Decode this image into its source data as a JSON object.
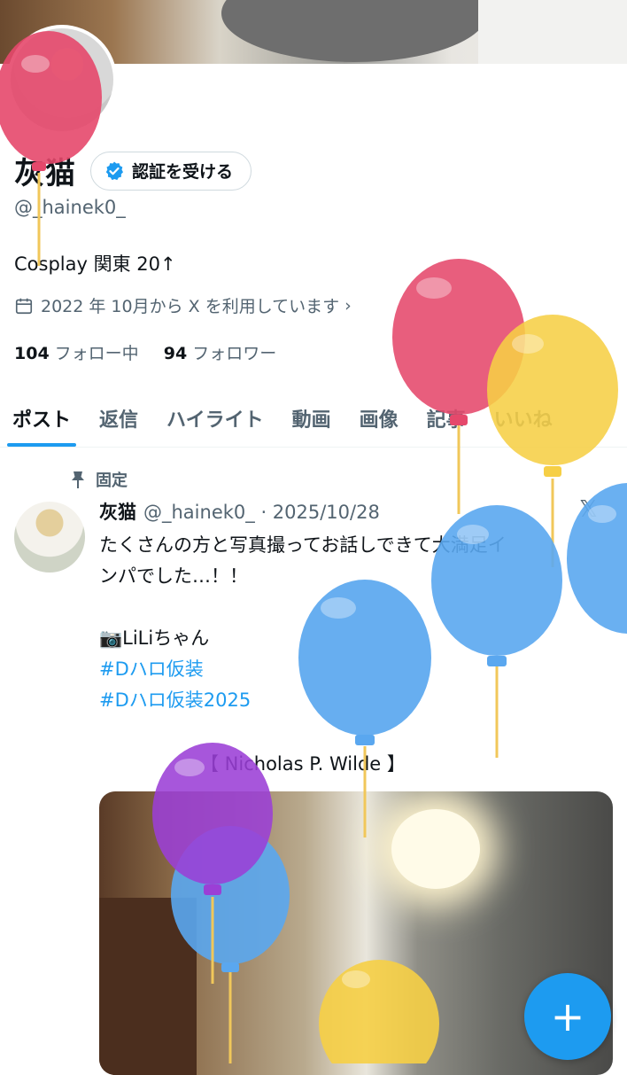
{
  "profile": {
    "name": "灰猫",
    "verify_label": "認証を受ける",
    "handle": "@_hainek0_",
    "bio": "Cosplay 関東 20↑",
    "joined": "2022 年 10月から X を利用しています",
    "following_count": "104",
    "following_label": "フォロー中",
    "followers_count": "94",
    "followers_label": "フォロワー"
  },
  "tabs": [
    {
      "label": "ポスト"
    },
    {
      "label": "返信"
    },
    {
      "label": "ハイライト"
    },
    {
      "label": "動画"
    },
    {
      "label": "画像"
    },
    {
      "label": "記事"
    },
    {
      "label": "いいね"
    }
  ],
  "post": {
    "pinned_label": "固定",
    "author": "灰猫",
    "handle_date": "@_hainek0_ · 2025/10/28",
    "text_line1": "たくさんの方と写真撮ってお話しできて大満足イ",
    "text_line2": "ンパでした…！！",
    "text_line3": "📷LiLiちゃん",
    "hashtag1": "#Dハロ仮装",
    "hashtag2": "#Dハロ仮装2025",
    "caption": "【 Nicholas P. Wilde 】"
  },
  "fab_label": "+",
  "colors": {
    "accent": "#1d9bf0",
    "balloon_red": "#e5486b",
    "balloon_yellow": "#f6cf45",
    "balloon_blue": "#5aa7ef",
    "balloon_purple": "#9b3fd6"
  },
  "icons": {
    "verified": "verified-badge-icon",
    "calendar": "calendar-icon",
    "pin": "pin-icon",
    "x_logo": "x-logo-icon",
    "compose": "plus-icon"
  }
}
